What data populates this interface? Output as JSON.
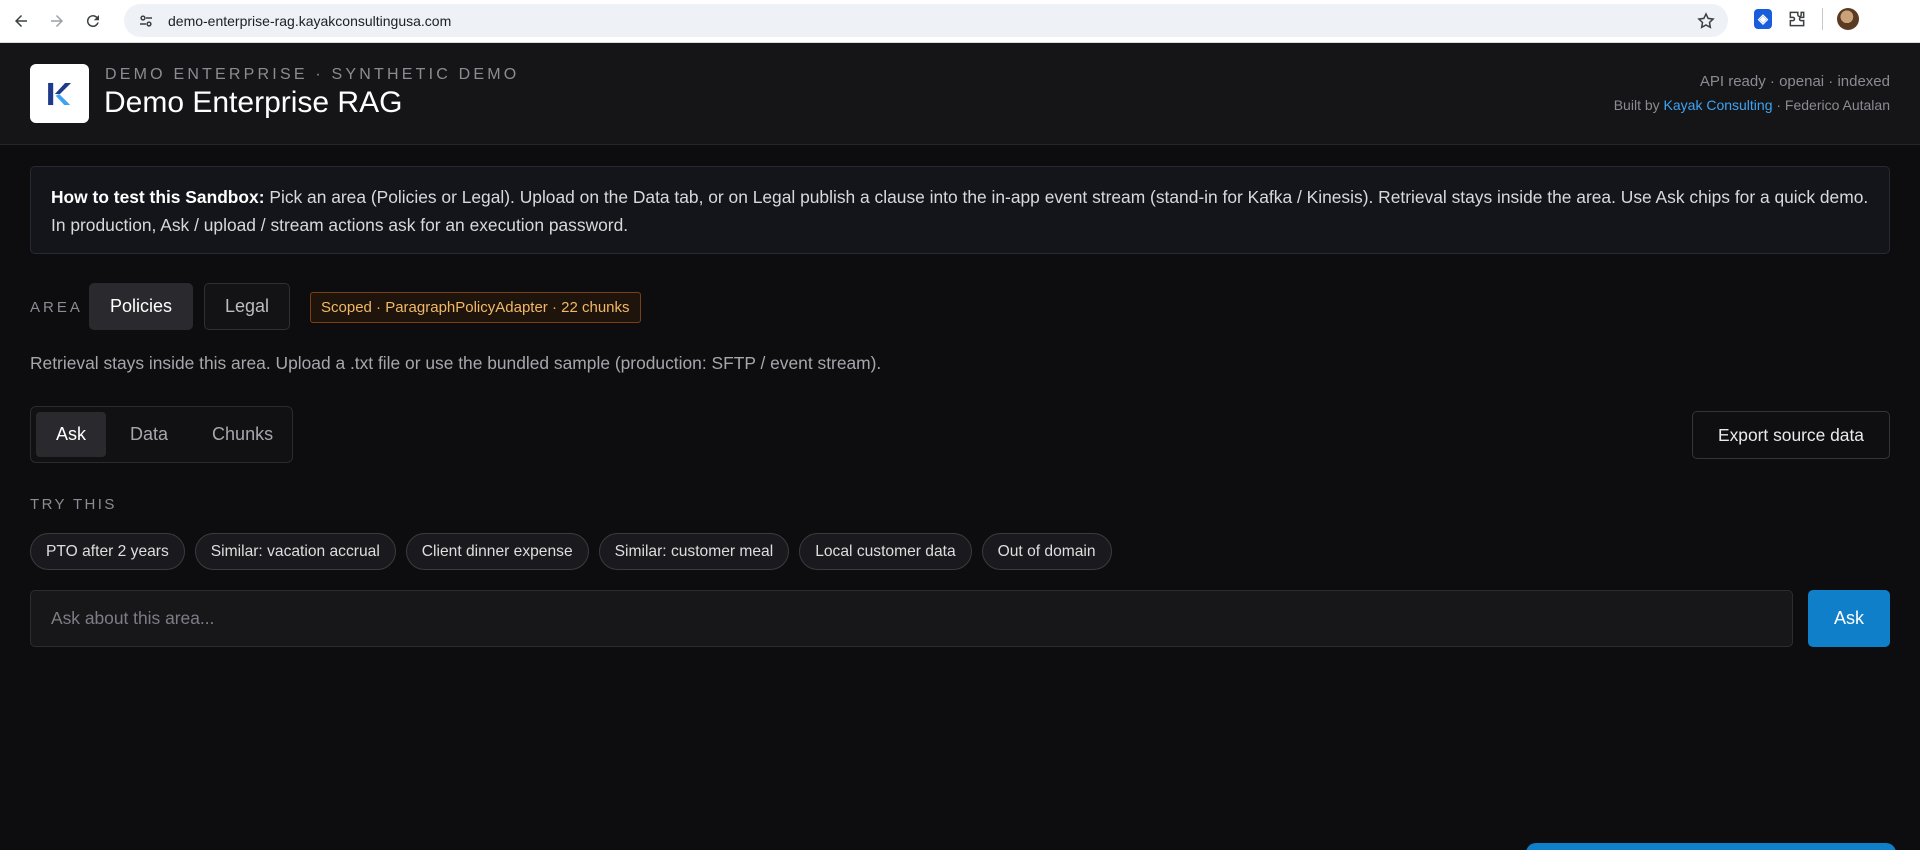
{
  "browser": {
    "url": "demo-enterprise-rag.kayakconsultingusa.com",
    "icons": [
      "back-arrow-icon",
      "forward-arrow-icon",
      "reload-icon",
      "site-info-icon",
      "bookmark-star-icon",
      "bitwarden-icon",
      "extensions-icon",
      "profile-avatar"
    ]
  },
  "header": {
    "eyebrow": "DEMO ENTERPRISE · SYNTHETIC DEMO",
    "title": "Demo Enterprise RAG",
    "status": "API ready · openai · indexed",
    "credit_prefix": "Built by ",
    "credit_link": "Kayak Consulting",
    "credit_suffix": " · Federico Autalan"
  },
  "info": {
    "bold": "How to test this Sandbox:",
    "text": " Pick an area (Policies or Legal). Upload on the Data tab, or on Legal publish a clause into the in-app event stream (stand-in for Kafka / Kinesis). Retrieval stays inside the area. Use Ask chips for a quick demo. In production, Ask / upload / stream actions ask for an execution password."
  },
  "area": {
    "label": "AREA",
    "options": [
      "Policies",
      "Legal"
    ],
    "selected": "Policies",
    "badge": "Scoped · ParagraphPolicyAdapter · 22 chunks",
    "hint": "Retrieval stays inside this area. Upload a .txt file or use the bundled sample (production: SFTP / event stream)."
  },
  "tabs": {
    "items": [
      "Ask",
      "Data",
      "Chunks"
    ],
    "active": "Ask",
    "export_label": "Export source data"
  },
  "try_this": {
    "label": "TRY THIS",
    "chips": [
      "PTO after 2 years",
      "Similar: vacation accrual",
      "Client dinner expense",
      "Similar: customer meal",
      "Local customer data",
      "Out of domain"
    ]
  },
  "ask": {
    "placeholder": "Ask about this area...",
    "value": "",
    "button": "Ask"
  },
  "colors": {
    "background": "#0d0d0f",
    "accent": "#0f7fc9",
    "link": "#3ea3f2",
    "badge_text": "#f0b867"
  }
}
